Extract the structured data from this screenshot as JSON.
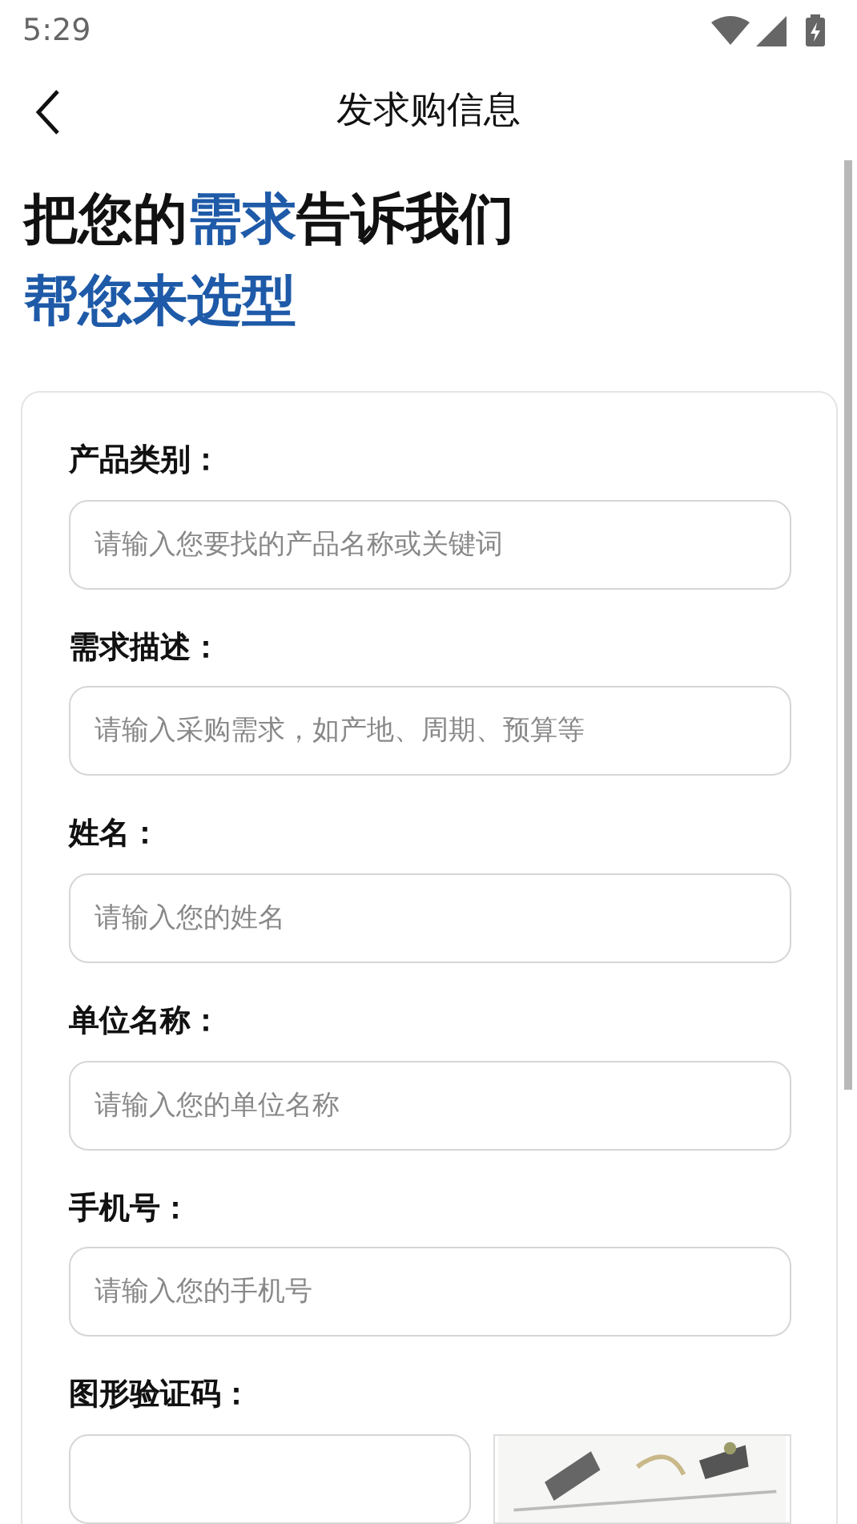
{
  "status_bar": {
    "time": "5:29"
  },
  "header": {
    "title": "发求购信息"
  },
  "headline": [
    [
      {
        "text": "把您的",
        "highlight": false
      },
      {
        "text": "需求",
        "highlight": true
      },
      {
        "text": "告诉我们",
        "highlight": false
      }
    ],
    [
      {
        "text": "帮您来选型",
        "highlight": true
      }
    ]
  ],
  "form": {
    "fields": [
      {
        "label": "产品类别：",
        "placeholder": "请输入您要找的产品名称或关键词"
      },
      {
        "label": "需求描述：",
        "placeholder": "请输入采购需求，如产地、周期、预算等"
      },
      {
        "label": "姓名：",
        "placeholder": "请输入您的姓名"
      },
      {
        "label": "单位名称：",
        "placeholder": "请输入您的单位名称"
      },
      {
        "label": "手机号：",
        "placeholder": "请输入您的手机号"
      }
    ],
    "captcha": {
      "label": "图形验证码："
    }
  }
}
